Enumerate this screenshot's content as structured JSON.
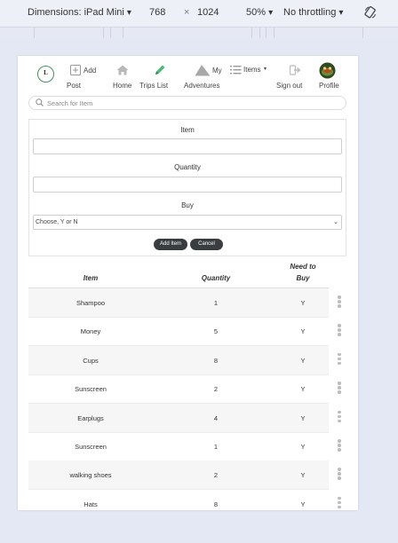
{
  "devtools": {
    "dimensions_label": "Dimensions: iPad Mini",
    "width": "768",
    "times": "×",
    "height": "1024",
    "zoom": "50%",
    "throttle": "No throttling",
    "arrow": "▾"
  },
  "nav": {
    "logo_text": "L",
    "add_post_top": "Add",
    "add_post_bottom": "Post",
    "home": "Home",
    "trips_list": "Trips List",
    "my_adventures_top": "My",
    "my_adventures_bottom": "Adventures",
    "items": "Items",
    "sign_out": "Sign out",
    "profile": "Profile"
  },
  "search": {
    "placeholder": "Search for Item"
  },
  "form": {
    "item_label": "Item",
    "quantity_label": "Quantity",
    "buy_label": "Buy",
    "buy_selected": "Choose, Y or N",
    "add_button": "Add Item",
    "cancel_button": "Cancel"
  },
  "table": {
    "headers": {
      "item": "Item",
      "quantity": "Quantity",
      "need_line1": "Need to",
      "need_line2": "Buy"
    },
    "rows": [
      {
        "item": "Shampoo",
        "quantity": "1",
        "buy": "Y"
      },
      {
        "item": "Money",
        "quantity": "5",
        "buy": "Y"
      },
      {
        "item": "Cups",
        "quantity": "8",
        "buy": "Y"
      },
      {
        "item": "Sunscreen",
        "quantity": "2",
        "buy": "Y"
      },
      {
        "item": "Earplugs",
        "quantity": "4",
        "buy": "Y"
      },
      {
        "item": "Sunscreen",
        "quantity": "1",
        "buy": "Y"
      },
      {
        "item": "walking shoes",
        "quantity": "2",
        "buy": "Y"
      },
      {
        "item": "Hats",
        "quantity": "8",
        "buy": "Y"
      }
    ]
  },
  "colors": {
    "accent_green": "#3a9a5c",
    "button_dark": "#3a3d40",
    "page_bg": "#e4e8f4"
  }
}
